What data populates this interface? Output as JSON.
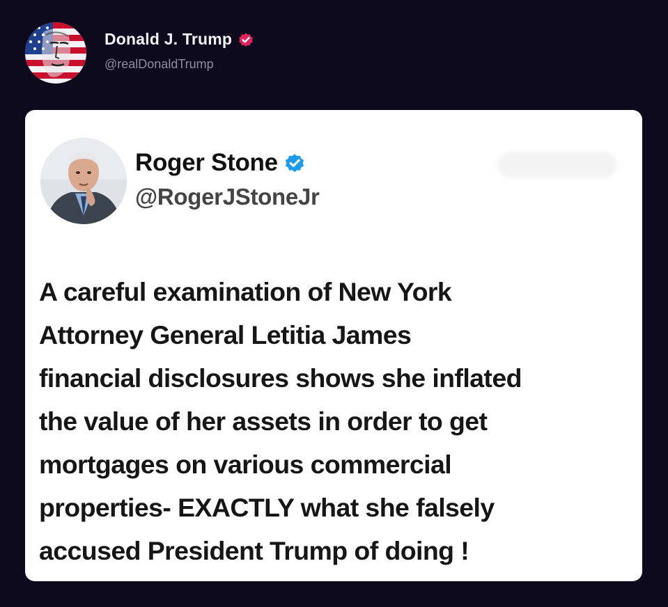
{
  "post": {
    "author_name": "Donald J. Trump",
    "author_handle": "@realDonaldTrump",
    "author_avatar": "flag-face-avatar",
    "verified_icon": "pink-verified-badge-icon",
    "verified_color": "#e0245e"
  },
  "quoted": {
    "author_name": "Roger Stone",
    "author_handle": "@RogerJStoneJr",
    "author_avatar": "man-in-suit-photo-avatar",
    "verified_icon": "blue-verified-badge-icon",
    "verified_color": "#1d9bf0",
    "text": "A careful examination of New York\nAttorney General Letitia James\nfinancial disclosures shows she inflated\nthe value of her assets in order to get\nmortgages on various commercial\nproperties- EXACTLY what she falsely\naccused President Trump of doing !"
  },
  "colors": {
    "background": "#0c0a1c",
    "card": "#ffffff",
    "handle_muted": "#8f8ea0"
  }
}
